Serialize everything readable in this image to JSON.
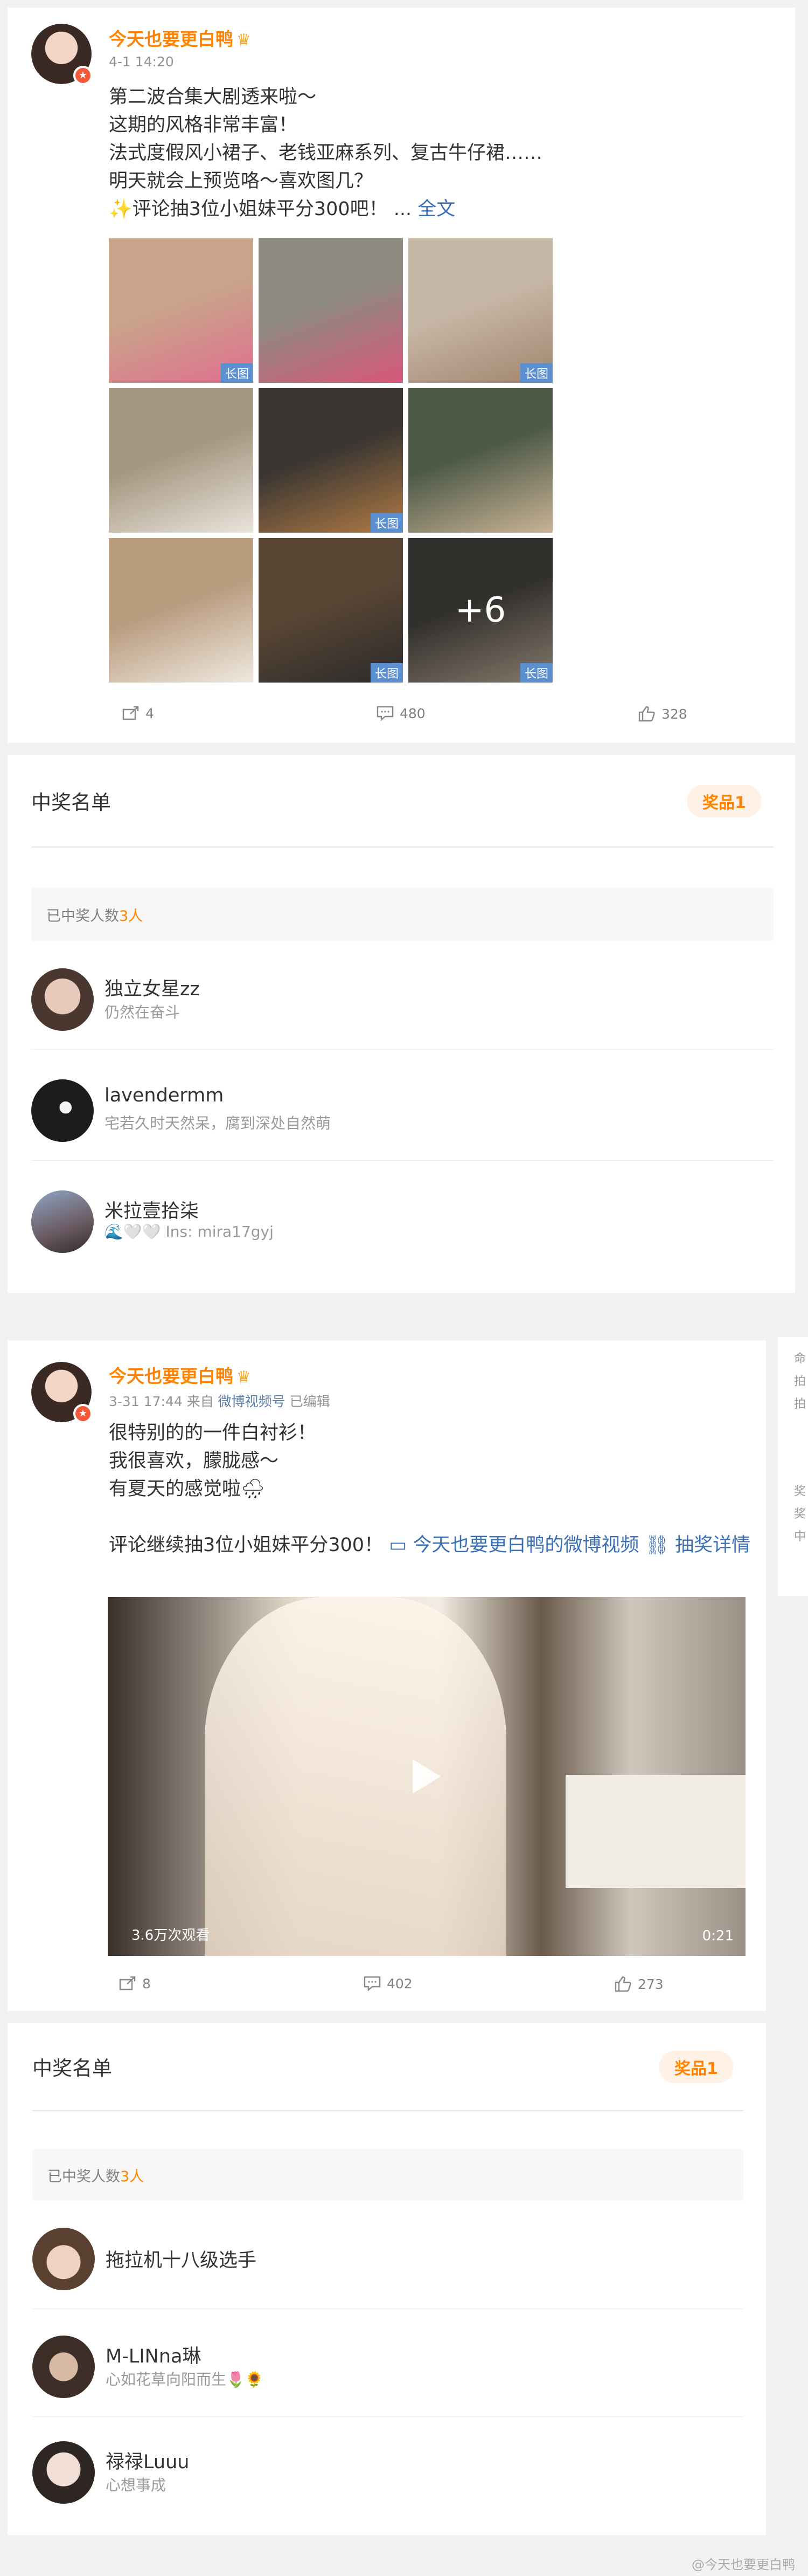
{
  "post1": {
    "author": "今天也要更白鸭",
    "time": "4-1 14:20",
    "lines": [
      "第二波合集大剧透来啦～",
      "这期的风格非常丰富！",
      "法式度假风小裙子、老钱亚麻系列、复古牛仔裙……",
      "明天就会上预览咯～喜欢图几？",
      "✨评论抽3位小姐妹平分300吧！ ..."
    ],
    "full_text_link": "全文",
    "images": [
      {
        "badge": "长图",
        "colors": [
          "#c9a48a",
          "#e06f8f"
        ]
      },
      {
        "badge": "",
        "colors": [
          "#8d8a80",
          "#d9577c"
        ]
      },
      {
        "badge": "长图",
        "colors": [
          "#c7b7a6",
          "#a2866f"
        ]
      },
      {
        "badge": "",
        "colors": [
          "#a59680",
          "#e9e4dc"
        ]
      },
      {
        "badge": "长图",
        "colors": [
          "#3a3632",
          "#b07a44"
        ]
      },
      {
        "badge": "",
        "colors": [
          "#4e5a48",
          "#c9b395"
        ]
      },
      {
        "badge": "",
        "colors": [
          "#b89a7d",
          "#efe9df"
        ]
      },
      {
        "badge": "长图",
        "colors": [
          "#5a4634",
          "#2b2b2b"
        ]
      },
      {
        "badge": "长图",
        "more": "+6",
        "colors": [
          "#4d4a46",
          "#cbb9a3"
        ]
      }
    ],
    "actions": {
      "repost": "4",
      "comment": "480",
      "like": "328"
    }
  },
  "winners1": {
    "title": "中奖名单",
    "prize_label": "奖品1",
    "count_label": "已中奖人数",
    "count_value": "3人",
    "items": [
      {
        "name": "独立女星zz",
        "bio": "仍然在奋斗",
        "color": "#c79b8f"
      },
      {
        "name": "lavendermm",
        "bio": "宅若久时天然呆，腐到深处自然萌",
        "color": "#1c1c1c"
      },
      {
        "name": "米拉壹拾柒",
        "bio": "🌊🤍🤍 Ins: mira17gyj",
        "color": "#7f6a72"
      }
    ]
  },
  "post2": {
    "author": "今天也要更白鸭",
    "time": "3-31 17:44",
    "source_prefix": "来自",
    "source": "微博视频号",
    "edited": "已编辑",
    "lines": [
      "很特别的的一件白衬衫！",
      "我很喜欢，朦胧感～",
      "有夏天的感觉啦🌧"
    ],
    "raffle_text": "评论继续抽3位小姐妹平分300！",
    "video_link": "今天也要更白鸭的微博视频",
    "raffle_link": "抽奖详情",
    "video": {
      "views": "3.6万次观看",
      "duration": "0:21"
    },
    "actions": {
      "repost": "8",
      "comment": "402",
      "like": "273"
    }
  },
  "winners2": {
    "title": "中奖名单",
    "prize_label": "奖品1",
    "count_label": "已中奖人数",
    "count_value": "3人",
    "items": [
      {
        "name": "拖拉机十八级选手",
        "bio": "",
        "color": "#a98a7a"
      },
      {
        "name": "M-LINna琳",
        "bio": "心如花草向阳而生🌷🌻",
        "color": "#6a5a4e"
      },
      {
        "name": "禄禄Luuu",
        "bio": "心想事成",
        "color": "#d8c9c2"
      }
    ]
  },
  "side": {
    "lines": [
      "命",
      "拍",
      "拍",
      "奖",
      "奖",
      "中"
    ]
  },
  "watermark": "@今天也要更白鸭"
}
